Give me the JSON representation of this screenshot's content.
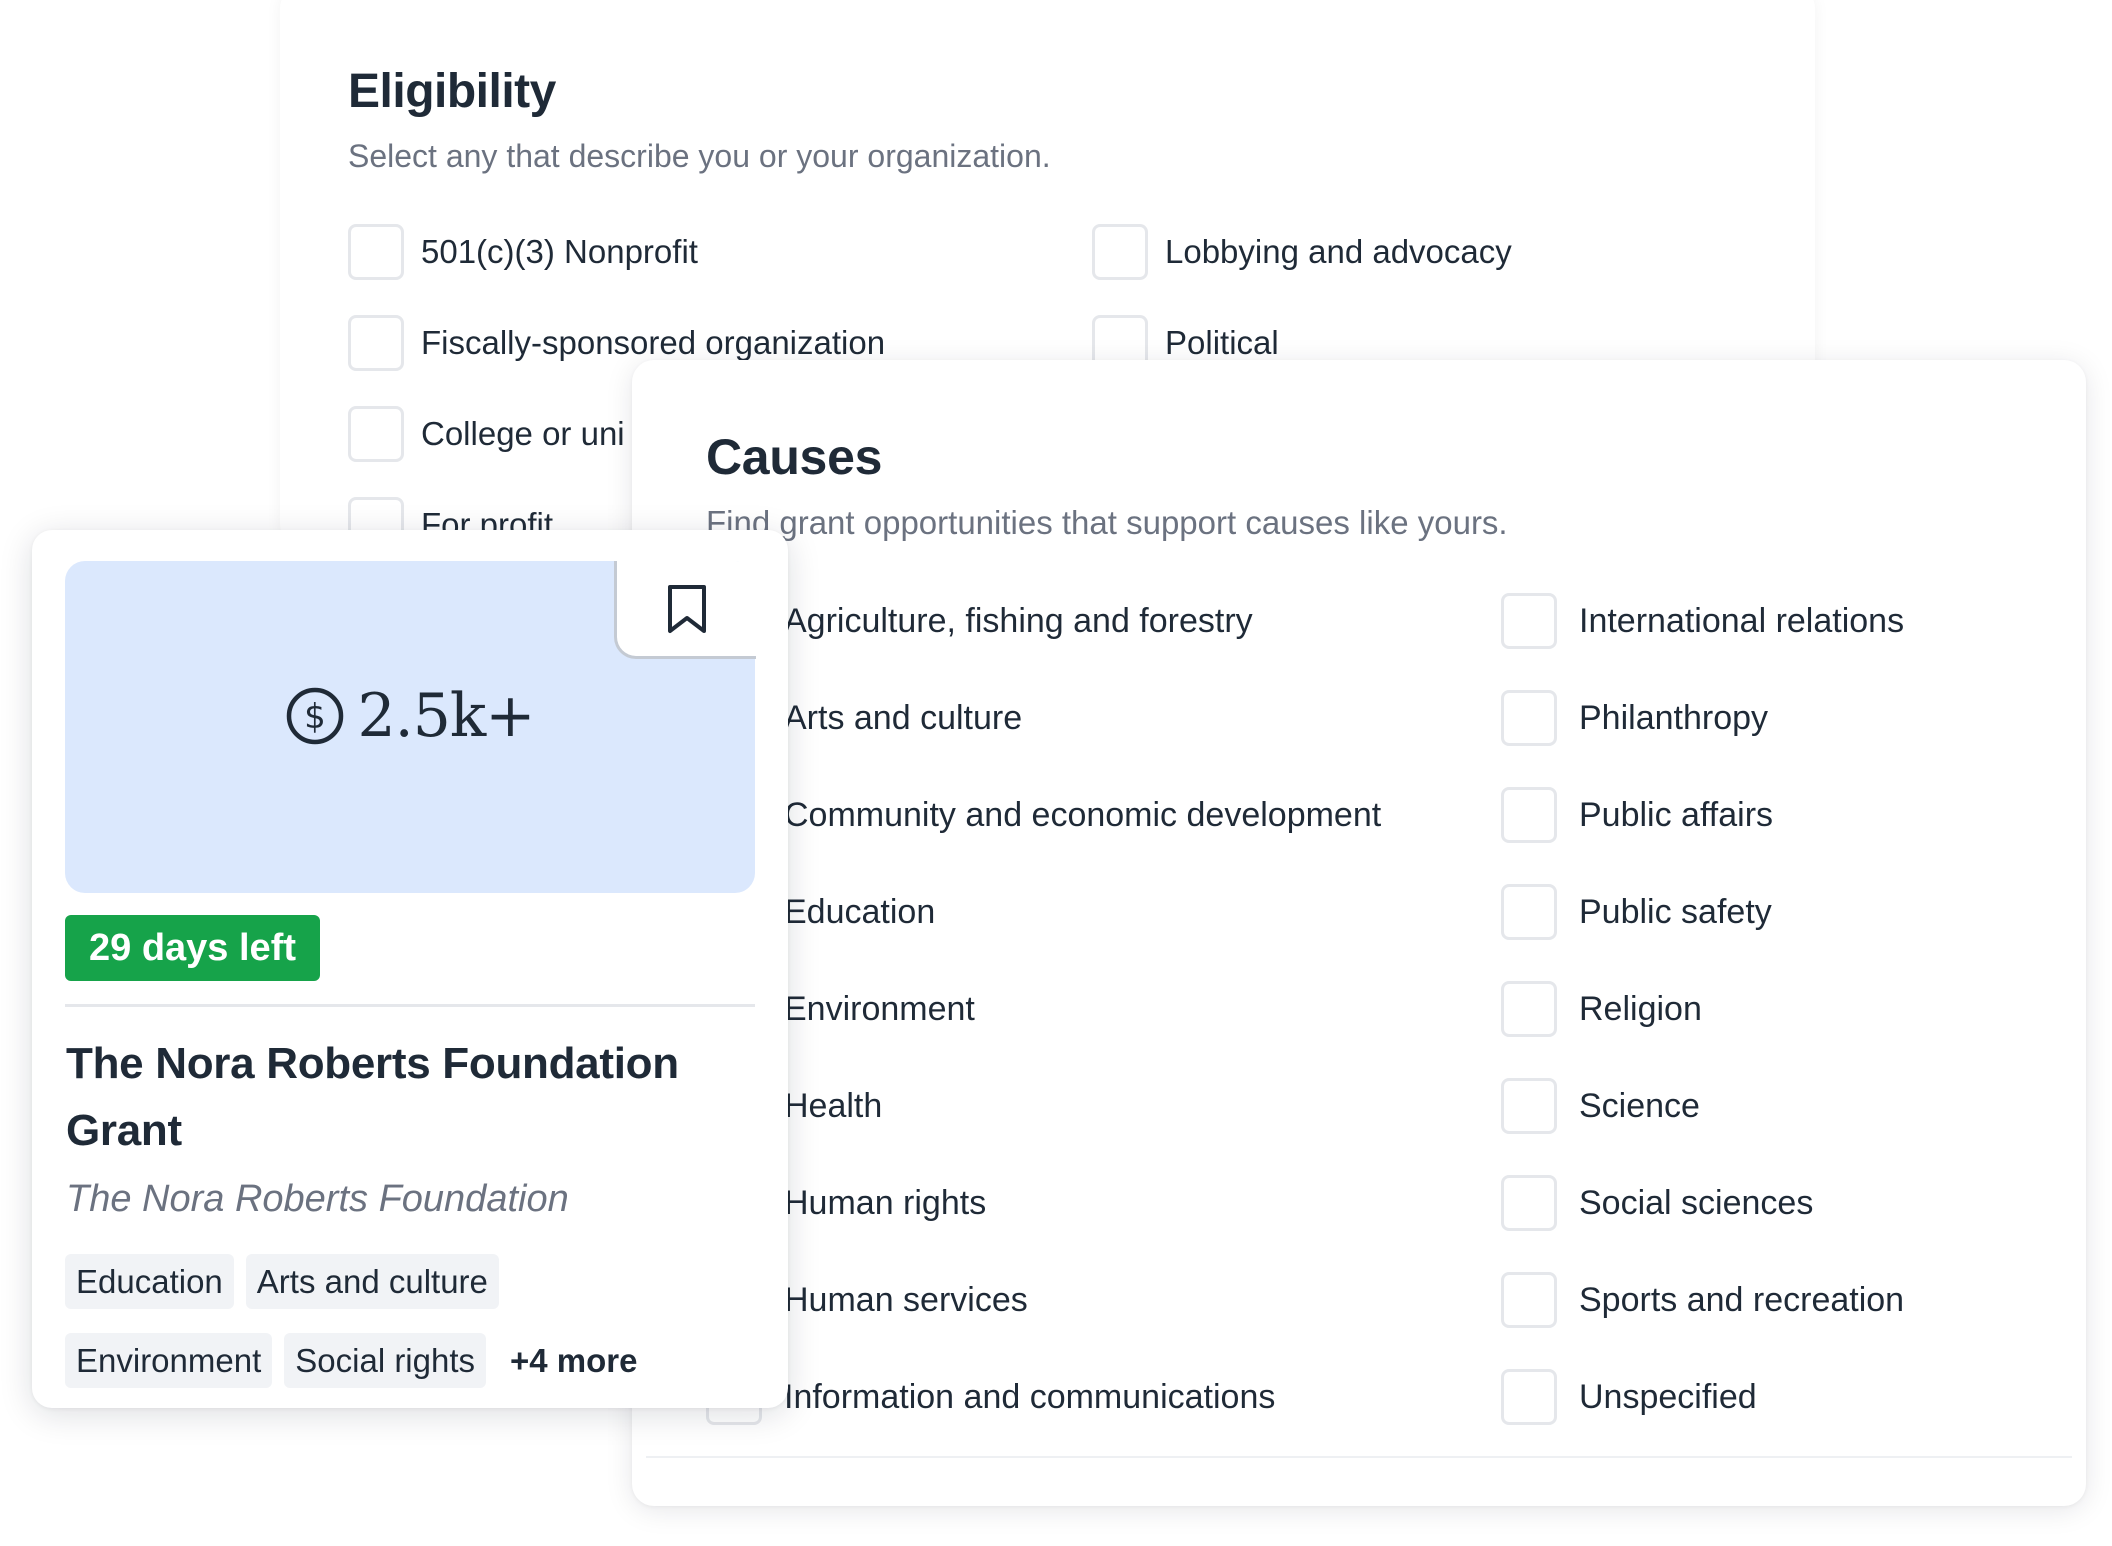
{
  "eligibility": {
    "title": "Eligibility",
    "subtitle": "Select any that describe you or your organization.",
    "options": [
      {
        "label": "501(c)(3) Nonprofit",
        "checked": false
      },
      {
        "label": "Fiscally-sponsored organization",
        "checked": false
      },
      {
        "label": "College or uni",
        "checked": false
      },
      {
        "label": "For profit",
        "checked": false
      },
      {
        "label": "Lobbying and advocacy",
        "checked": false
      },
      {
        "label": "Political",
        "checked": false
      }
    ]
  },
  "causes": {
    "title": "Causes",
    "subtitle": "Find grant opportunities that support causes like yours.",
    "left_options": [
      {
        "label": "Agriculture, fishing and forestry",
        "checked": false
      },
      {
        "label": "Arts and culture",
        "checked": false
      },
      {
        "label": "Community and economic development",
        "checked": false
      },
      {
        "label": "Education",
        "checked": false
      },
      {
        "label": "Environment",
        "checked": false
      },
      {
        "label": "Health",
        "checked": false
      },
      {
        "label": "Human rights",
        "checked": false
      },
      {
        "label": "Human services",
        "checked": false
      },
      {
        "label": "Information and communications",
        "checked": false
      }
    ],
    "right_options": [
      {
        "label": "International relations",
        "checked": false
      },
      {
        "label": "Philanthropy",
        "checked": false
      },
      {
        "label": "Public affairs",
        "checked": false
      },
      {
        "label": "Public safety",
        "checked": false
      },
      {
        "label": "Religion",
        "checked": false
      },
      {
        "label": "Science",
        "checked": false
      },
      {
        "label": "Social sciences",
        "checked": false
      },
      {
        "label": "Sports and recreation",
        "checked": false
      },
      {
        "label": "Unspecified",
        "checked": false
      }
    ]
  },
  "grant_card": {
    "amount": "2.5k+",
    "amount_icon": "dollar-circle-icon",
    "bookmark_icon": "bookmark-icon",
    "deadline_badge": "29 days left",
    "title": "The Nora Roberts Foundation Grant",
    "organization": "The Nora Roberts Foundation",
    "tags": [
      "Education",
      "Arts and culture",
      "Environment",
      "Social rights"
    ],
    "more_tags": "+4 more"
  },
  "colors": {
    "heading": "#1f2a37",
    "muted_text": "#6b7280",
    "checkbox_border": "#e5e7eb",
    "hero_background": "#dbe8fd",
    "badge_green": "#16a34a",
    "tag_background": "#f1f3f6"
  }
}
